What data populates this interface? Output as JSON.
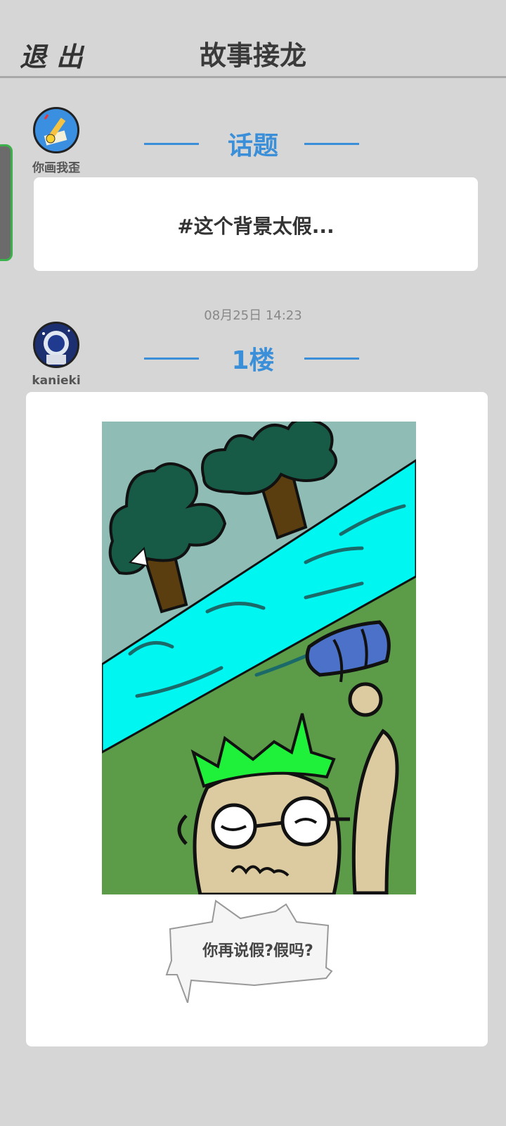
{
  "header": {
    "exit_label": "退出",
    "title": "故事接龙"
  },
  "topic": {
    "username": "你画我歪",
    "heading": "话题",
    "text": "#这个背景太假..."
  },
  "post": {
    "timestamp": "08月25日  14:23",
    "username": "kanieki",
    "floor_label": "1楼",
    "speech_text": "你再说假?假吗?"
  },
  "colors": {
    "accent": "#3a8fd8",
    "background": "#d6d6d6",
    "card": "#ffffff",
    "side_tab_border": "#3cb04a"
  }
}
